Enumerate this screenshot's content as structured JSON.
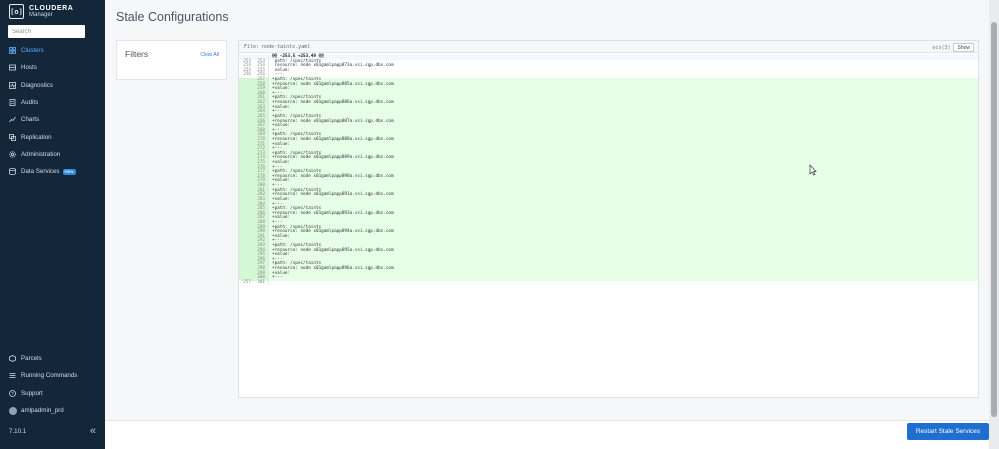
{
  "brand": {
    "name": "CLOUDERA",
    "sub": "Manager",
    "logo": "[o]"
  },
  "search": {
    "placeholder": "Search"
  },
  "nav": [
    {
      "label": "Clusters",
      "icon": "clusters-icon",
      "active": true
    },
    {
      "label": "Hosts",
      "icon": "hosts-icon"
    },
    {
      "label": "Diagnostics",
      "icon": "diagnostics-icon"
    },
    {
      "label": "Audits",
      "icon": "audits-icon"
    },
    {
      "label": "Charts",
      "icon": "charts-icon"
    },
    {
      "label": "Replication",
      "icon": "replication-icon"
    },
    {
      "label": "Administration",
      "icon": "gear-icon"
    },
    {
      "label": "Data Services",
      "icon": "data-services-icon",
      "badge": "New"
    }
  ],
  "nav_bottom": [
    {
      "label": "Parcels",
      "icon": "parcels-icon"
    },
    {
      "label": "Running Commands",
      "icon": "running-commands-icon"
    },
    {
      "label": "Support",
      "icon": "support-icon"
    },
    {
      "label": "amlpadmin_prd",
      "icon": "user-avatar"
    }
  ],
  "version": "7.10.1",
  "collapse_glyph": "«",
  "page": {
    "title": "Stale Configurations"
  },
  "filters": {
    "title": "Filters",
    "clear_all": "Clear All"
  },
  "diff": {
    "file_label": "File: node-taints.yaml",
    "right_label": "ecs(3)",
    "show_label": "Show",
    "lines": [
      {
        "a": "",
        "b": "",
        "text": "@@ -253,5 +253,49 @@",
        "type": "hunk"
      },
      {
        "a": "253",
        "b": "253",
        "text": " path: /spec/taints",
        "type": "ctx"
      },
      {
        "a": "254",
        "b": "254",
        "text": " resource: node x01gamlpapp873a.vsi.sgp.dbs.com",
        "type": "ctx"
      },
      {
        "a": "255",
        "b": "255",
        "text": " value:",
        "type": "ctx"
      },
      {
        "a": "256",
        "b": "256",
        "text": " ---",
        "type": "ctx"
      },
      {
        "a": "",
        "b": "257",
        "text": "+path: /spec/taints",
        "type": "add"
      },
      {
        "a": "",
        "b": "258",
        "text": "+resource: node x01gamlpapp885a.vsi.sgp.dbs.com",
        "type": "add"
      },
      {
        "a": "",
        "b": "259",
        "text": "+value:",
        "type": "add"
      },
      {
        "a": "",
        "b": "260",
        "text": "+---",
        "type": "add"
      },
      {
        "a": "",
        "b": "261",
        "text": "+path: /spec/taints",
        "type": "add"
      },
      {
        "a": "",
        "b": "262",
        "text": "+resource: node x01gamlpapp886a.vsi.sgp.dbs.com",
        "type": "add"
      },
      {
        "a": "",
        "b": "263",
        "text": "+value:",
        "type": "add"
      },
      {
        "a": "",
        "b": "264",
        "text": "+---",
        "type": "add"
      },
      {
        "a": "",
        "b": "265",
        "text": "+path: /spec/taints",
        "type": "add"
      },
      {
        "a": "",
        "b": "266",
        "text": "+resource: node x01gamlpapp887a.vsi.sgp.dbs.com",
        "type": "add"
      },
      {
        "a": "",
        "b": "267",
        "text": "+value:",
        "type": "add"
      },
      {
        "a": "",
        "b": "268",
        "text": "+---",
        "type": "add"
      },
      {
        "a": "",
        "b": "269",
        "text": "+path: /spec/taints",
        "type": "add"
      },
      {
        "a": "",
        "b": "270",
        "text": "+resource: node x01gamlpapp888a.vsi.sgp.dbs.com",
        "type": "add"
      },
      {
        "a": "",
        "b": "271",
        "text": "+value:",
        "type": "add"
      },
      {
        "a": "",
        "b": "272",
        "text": "+---",
        "type": "add"
      },
      {
        "a": "",
        "b": "273",
        "text": "+path: /spec/taints",
        "type": "add"
      },
      {
        "a": "",
        "b": "274",
        "text": "+resource: node x01gamlpapp889a.vsi.sgp.dbs.com",
        "type": "add"
      },
      {
        "a": "",
        "b": "275",
        "text": "+value:",
        "type": "add"
      },
      {
        "a": "",
        "b": "276",
        "text": "+---",
        "type": "add"
      },
      {
        "a": "",
        "b": "277",
        "text": "+path: /spec/taints",
        "type": "add"
      },
      {
        "a": "",
        "b": "278",
        "text": "+resource: node x01gamlpapp890a.vsi.sgp.dbs.com",
        "type": "add"
      },
      {
        "a": "",
        "b": "279",
        "text": "+value:",
        "type": "add"
      },
      {
        "a": "",
        "b": "280",
        "text": "+---",
        "type": "add"
      },
      {
        "a": "",
        "b": "281",
        "text": "+path: /spec/taints",
        "type": "add"
      },
      {
        "a": "",
        "b": "282",
        "text": "+resource: node x01gamlpapp891a.vsi.sgp.dbs.com",
        "type": "add"
      },
      {
        "a": "",
        "b": "283",
        "text": "+value:",
        "type": "add"
      },
      {
        "a": "",
        "b": "284",
        "text": "+---",
        "type": "add"
      },
      {
        "a": "",
        "b": "285",
        "text": "+path: /spec/taints",
        "type": "add"
      },
      {
        "a": "",
        "b": "286",
        "text": "+resource: node x01gamlpapp893a.vsi.sgp.dbs.com",
        "type": "add"
      },
      {
        "a": "",
        "b": "287",
        "text": "+value:",
        "type": "add"
      },
      {
        "a": "",
        "b": "288",
        "text": "+---",
        "type": "add"
      },
      {
        "a": "",
        "b": "289",
        "text": "+path: /spec/taints",
        "type": "add"
      },
      {
        "a": "",
        "b": "290",
        "text": "+resource: node x01gamlpapp894a.vsi.sgp.dbs.com",
        "type": "add"
      },
      {
        "a": "",
        "b": "291",
        "text": "+value:",
        "type": "add"
      },
      {
        "a": "",
        "b": "292",
        "text": "+---",
        "type": "add"
      },
      {
        "a": "",
        "b": "293",
        "text": "+path: /spec/taints",
        "type": "add"
      },
      {
        "a": "",
        "b": "294",
        "text": "+resource: node x01gamlpapp895a.vsi.sgp.dbs.com",
        "type": "add"
      },
      {
        "a": "",
        "b": "295",
        "text": "+value:",
        "type": "add"
      },
      {
        "a": "",
        "b": "296",
        "text": "+---",
        "type": "add"
      },
      {
        "a": "",
        "b": "297",
        "text": "+path: /spec/taints",
        "type": "add"
      },
      {
        "a": "",
        "b": "298",
        "text": "+resource: node x01gamlpapp896a.vsi.sgp.dbs.com",
        "type": "add"
      },
      {
        "a": "",
        "b": "299",
        "text": "+value:",
        "type": "add"
      },
      {
        "a": "",
        "b": "300",
        "text": "+---",
        "type": "add"
      },
      {
        "a": "257",
        "b": "301",
        "text": "",
        "type": "ctx"
      }
    ]
  },
  "footer": {
    "restart_label": "Restart Stale Services"
  },
  "colors": {
    "sidebar": "#14263a",
    "accent": "#1f6fd1",
    "added_line": "#e6ffe6",
    "active_nav": "#5fb4ff"
  }
}
